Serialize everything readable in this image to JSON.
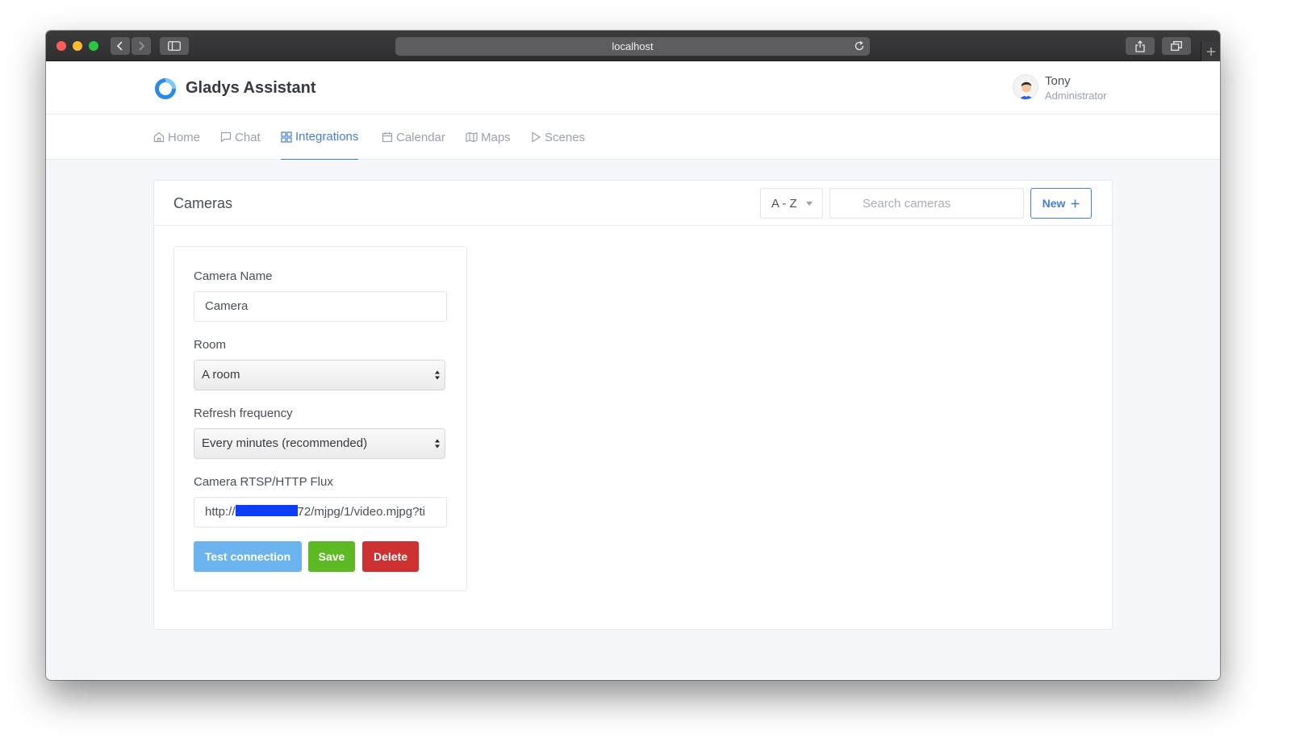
{
  "browser": {
    "url": "localhost"
  },
  "app": {
    "name": "Gladys Assistant",
    "accent": "#467fcf"
  },
  "user": {
    "name": "Tony",
    "role": "Administrator"
  },
  "nav": {
    "items": [
      {
        "label": "Home",
        "icon": "home-icon",
        "active": false
      },
      {
        "label": "Chat",
        "icon": "chat-icon",
        "active": false
      },
      {
        "label": "Integrations",
        "icon": "grid-icon",
        "active": true
      },
      {
        "label": "Calendar",
        "icon": "calendar-icon",
        "active": false
      },
      {
        "label": "Maps",
        "icon": "map-icon",
        "active": false
      },
      {
        "label": "Scenes",
        "icon": "play-icon",
        "active": false
      }
    ]
  },
  "page": {
    "title": "Cameras",
    "sort_label": "A - Z",
    "search_placeholder": "Search cameras",
    "new_label": "New"
  },
  "form": {
    "name_label": "Camera Name",
    "name_value": "Camera",
    "room_label": "Room",
    "room_value": "A room",
    "refresh_label": "Refresh frequency",
    "refresh_value": "Every minutes (recommended)",
    "flux_label": "Camera RTSP/HTTP Flux",
    "flux_prefix": "http://",
    "flux_suffix": "72/mjpg/1/video.mjpg?ti",
    "test_label": "Test connection",
    "save_label": "Save",
    "delete_label": "Delete"
  },
  "colors": {
    "test": "#6bb4ef",
    "save": "#5eba24",
    "delete": "#cd3131"
  }
}
